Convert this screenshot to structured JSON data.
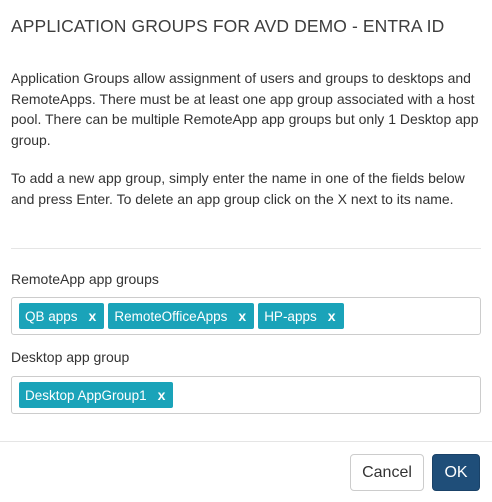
{
  "dialog": {
    "title": "APPLICATION GROUPS FOR AVD DEMO - ENTRA ID",
    "paragraph1": "Application Groups allow assignment of users and groups to desktops and RemoteApps. There must be at least one app group associated with a host pool. There can be multiple RemoteApp app groups but only 1 Desktop app group.",
    "paragraph2": "To add a new app group, simply enter the name in one of the fields below and press Enter. To delete an app group click on the X next to its name."
  },
  "remoteapp": {
    "label": "RemoteApp app groups",
    "tags": [
      "QB apps",
      "RemoteOfficeApps",
      "HP-apps"
    ],
    "input_value": ""
  },
  "desktop": {
    "label": "Desktop app group",
    "tags": [
      "Desktop AppGroup1"
    ],
    "input_value": ""
  },
  "tag_remove_glyph": "x",
  "buttons": {
    "cancel": "Cancel",
    "ok": "OK"
  },
  "colors": {
    "tag_background": "#1aa3b9",
    "ok_background": "#1f4e79"
  }
}
